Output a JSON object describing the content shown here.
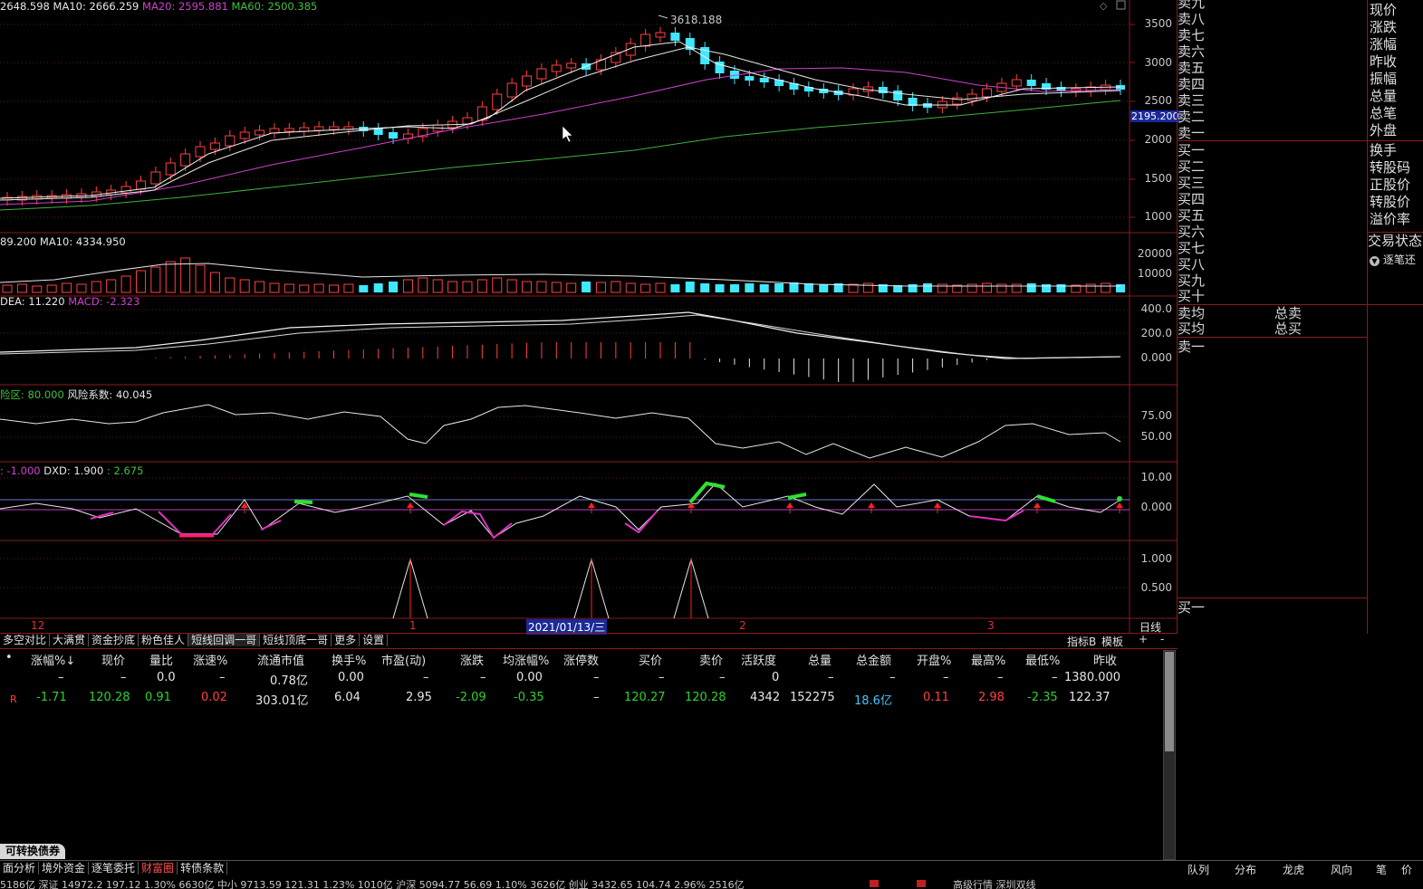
{
  "price_header": {
    "ma5": "2648.598",
    "ma10": "MA10: 2666.259",
    "ma20": "MA20: 2595.881",
    "ma60": "MA60: 2500.385"
  },
  "price_axis": [
    "3500",
    "3000",
    "2500",
    "2000",
    "1500",
    "1000"
  ],
  "price_peak_label": "3618.188",
  "price_cursor_label": "2195.200",
  "volume_header": {
    "v1": "89.200",
    "v2": "MA10: 4334.950"
  },
  "volume_axis": [
    "20000",
    "10000"
  ],
  "macd_header": {
    "dea": "DEA: 11.220",
    "macd": "MACD: -2.323"
  },
  "macd_axis": [
    "400.0",
    "200.0",
    "0.000"
  ],
  "risk_header": {
    "zone": "险区: 80.000",
    "coef": "风险系数: 40.045"
  },
  "risk_axis": [
    "75.00",
    "50.00"
  ],
  "dxd_header": {
    "a": ": -1.000",
    "b": "DXD: 1.900",
    "c": ": 2.675"
  },
  "dxd_axis": [
    "10.00",
    "0.000"
  ],
  "signal_axis": [
    "1.000",
    "0.500"
  ],
  "date_axis": {
    "m12": "12",
    "m1": "1",
    "cursor_date": "2021/01/13/三",
    "m2": "2",
    "m3": "3",
    "period": "日线"
  },
  "order_book": {
    "sell": [
      "卖九",
      "卖八",
      "卖七",
      "卖六",
      "卖五",
      "卖四",
      "卖三",
      "卖二",
      "卖一"
    ],
    "buy": [
      "买一",
      "买二",
      "买三",
      "买四",
      "买五",
      "买六",
      "买七",
      "买八",
      "买九",
      "买十"
    ],
    "avg_sell": "卖均",
    "avg_buy": "买均",
    "total_sell": "总卖",
    "total_buy": "总买",
    "sell_one": "卖一",
    "buy_one": "买一"
  },
  "right_panel": {
    "fields_a": [
      "现价",
      "涨跌",
      "涨幅",
      "昨收",
      "振幅",
      "总量",
      "总笔",
      "外盘"
    ],
    "fields_b": [
      "换手",
      "转股码",
      "正股价",
      "转股价",
      "溢价率"
    ],
    "trade_status": "交易状态",
    "tick_toggle": "逐笔还"
  },
  "indicator_tabs": [
    "多空对比",
    "大满贯",
    "资金抄底",
    "粉色佳人",
    "短线回调一哥",
    "短线顶底一哥",
    "更多",
    "设置"
  ],
  "indicator_tabs_right": [
    "指标B",
    "模板",
    "+",
    "-"
  ],
  "table": {
    "headers": [
      "•",
      "涨幅%↓",
      "现价",
      "量比",
      "涨速%",
      "流通市值",
      "换手%",
      "市盈(动)",
      "涨跌",
      "均涨幅%",
      "涨停数",
      "买价",
      "卖价",
      "活跃度",
      "总量",
      "总金额",
      "开盘%",
      "最高%",
      "最低%",
      "昨收"
    ],
    "rows": [
      [
        "",
        "–",
        "–",
        "0.0",
        "–",
        "0.78亿",
        "0.00",
        "–",
        "–",
        "0.00",
        "–",
        "–",
        "–",
        "0",
        "–",
        "–",
        "–",
        "–",
        "–",
        "1380.000"
      ],
      [
        "R",
        "-1.71",
        "120.28",
        "0.91",
        "0.02",
        "303.01亿",
        "6.04",
        "2.95",
        "-2.09",
        "-0.35",
        "–",
        "120.27",
        "120.28",
        "4342",
        "152275",
        "18.6亿",
        "0.11",
        "2.98",
        "-2.35",
        "122.37"
      ]
    ]
  },
  "bottom_tab": "可转换债券",
  "bottom_tabs": [
    "面分析",
    "境外资金",
    "逐笔委托",
    "财富圈",
    "转债条款"
  ],
  "right_bottom_tabs": [
    "队列",
    "分布",
    "龙虎",
    "风向",
    "笔",
    "价"
  ],
  "ticker": "5186亿  深证 14972.2  197.12  1.30%  6630亿   中小 9713.59  121.31  1.23%  1010亿   沪深 5094.77  56.69  1.10%  3626亿   创业 3432.65  104.74  2.96%  2516亿",
  "ticker_right": "高级行情  深圳双线",
  "colors": {
    "up": "#ff4040",
    "down": "#40e8ff",
    "ma5": "#e6e6e6",
    "ma20": "#d040d0",
    "ma60": "#40b040",
    "grid": "#8c1a1a"
  }
}
